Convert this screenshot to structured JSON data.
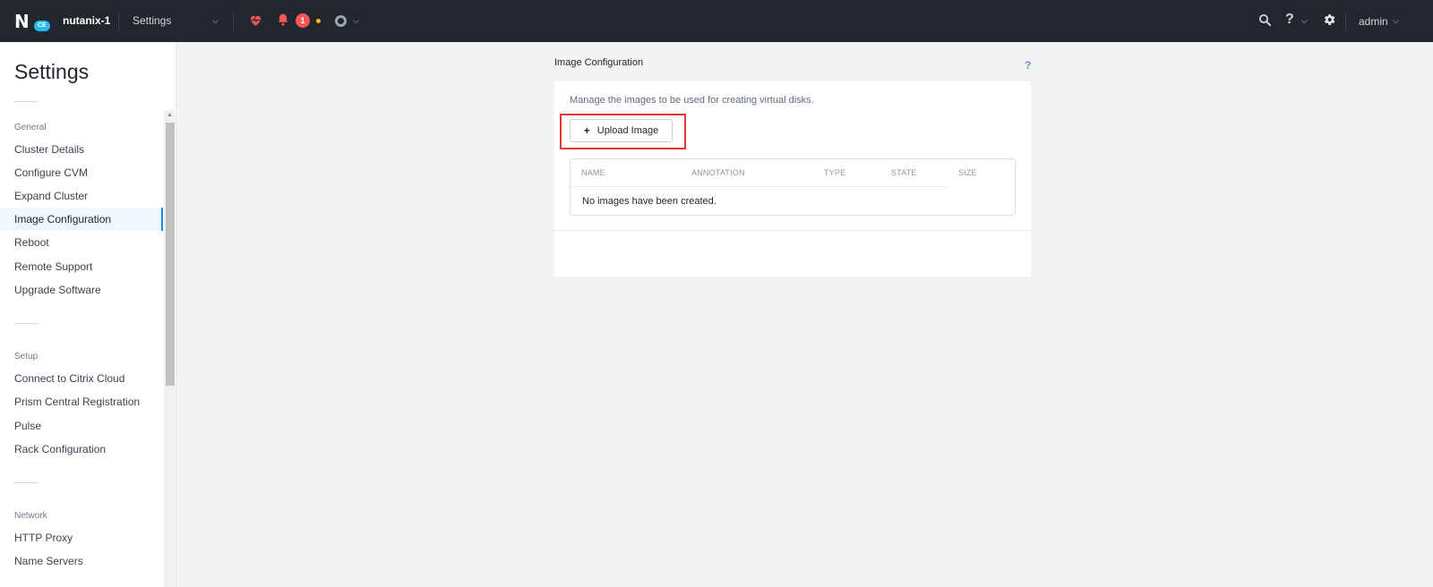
{
  "topbar": {
    "logo_letter": "N",
    "logo_badge": "CE",
    "cluster_name": "nutanix-1",
    "nav_label": "Settings",
    "alert_count": "1",
    "user": "admin",
    "help_glyph": "?",
    "icons": [
      "health-heart-icon",
      "alerts-bell-icon",
      "tasks-ring-icon",
      "search-icon",
      "help-icon",
      "gear-icon"
    ]
  },
  "sidebar": {
    "title": "Settings",
    "sections": [
      {
        "label": "General",
        "items": [
          "Cluster Details",
          "Configure CVM",
          "Expand Cluster",
          "Image Configuration",
          "Reboot",
          "Remote Support",
          "Upgrade Software"
        ]
      },
      {
        "label": "Setup",
        "items": [
          "Connect to Citrix Cloud",
          "Prism Central Registration",
          "Pulse",
          "Rack Configuration"
        ]
      },
      {
        "label": "Network",
        "items": [
          "HTTP Proxy",
          "Name Servers"
        ]
      }
    ],
    "active_item": "Image Configuration"
  },
  "main": {
    "title": "Image Configuration",
    "help": "?",
    "description": "Manage the images to be used for creating virtual disks.",
    "upload_button": "Upload Image",
    "upload_glyph": "+",
    "table": {
      "columns": [
        "NAME",
        "ANNOTATION",
        "TYPE",
        "STATE",
        "SIZE"
      ],
      "empty_message": "No images have been created."
    }
  },
  "colors": {
    "topbar_bg": "#22272e",
    "accent": "#1b8ae0",
    "alert": "#f55656",
    "highlight": "#e53935"
  }
}
